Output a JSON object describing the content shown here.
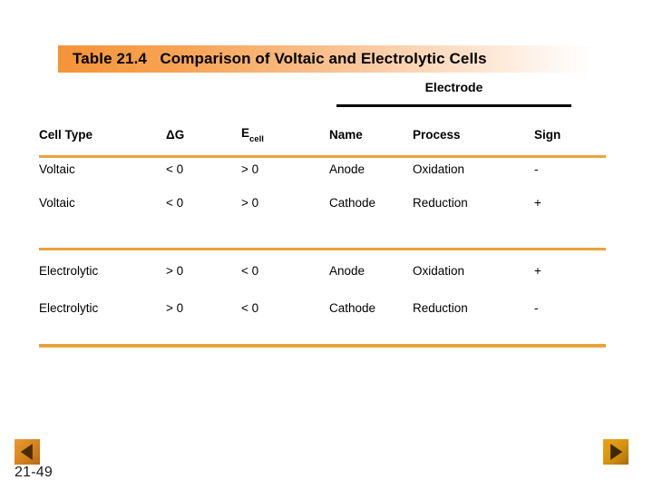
{
  "slide": {
    "title_prefix": "Table 21.4",
    "title_main": "Comparison of Voltaic and Electrolytic Cells",
    "title_full": "Table 21.4   Comparison of Voltaic and Electrolytic Cells",
    "page_label": "21-49",
    "accent_orange": "#e8a33d",
    "banner_orange": "#f59338",
    "rule_black": "#000000",
    "background": "#ffffff"
  },
  "table": {
    "group_header": {
      "label": "Electrode",
      "spans_columns": [
        "Name",
        "Process",
        "Sign"
      ]
    },
    "columns": [
      {
        "key": "cell_type",
        "label": "Cell Type"
      },
      {
        "key": "delta_g",
        "label": "ΔG"
      },
      {
        "key": "e_cell",
        "label": "E",
        "subscript": "cell"
      },
      {
        "key": "name",
        "label": "Name"
      },
      {
        "key": "process",
        "label": "Process"
      },
      {
        "key": "sign",
        "label": "Sign"
      }
    ],
    "groups": [
      {
        "name": "voltaic",
        "rows": [
          {
            "cell_type": "Voltaic",
            "delta_g": "< 0",
            "e_cell": "> 0",
            "name": "Anode",
            "process": "Oxidation",
            "sign": "-"
          },
          {
            "cell_type": "Voltaic",
            "delta_g": "< 0",
            "e_cell": "> 0",
            "name": "Cathode",
            "process": "Reduction",
            "sign": "+"
          }
        ]
      },
      {
        "name": "electrolytic",
        "rows": [
          {
            "cell_type": "Electrolytic",
            "delta_g": "> 0",
            "e_cell": "< 0",
            "name": "Anode",
            "process": "Oxidation",
            "sign": "+"
          },
          {
            "cell_type": "Electrolytic",
            "delta_g": "> 0",
            "e_cell": "< 0",
            "name": "Cathode",
            "process": "Reduction",
            "sign": "-"
          }
        ]
      }
    ]
  },
  "navigation": {
    "previous": {
      "icon": "triangle-left-icon",
      "label": ""
    },
    "next": {
      "icon": "triangle-right-icon",
      "label": ""
    }
  }
}
